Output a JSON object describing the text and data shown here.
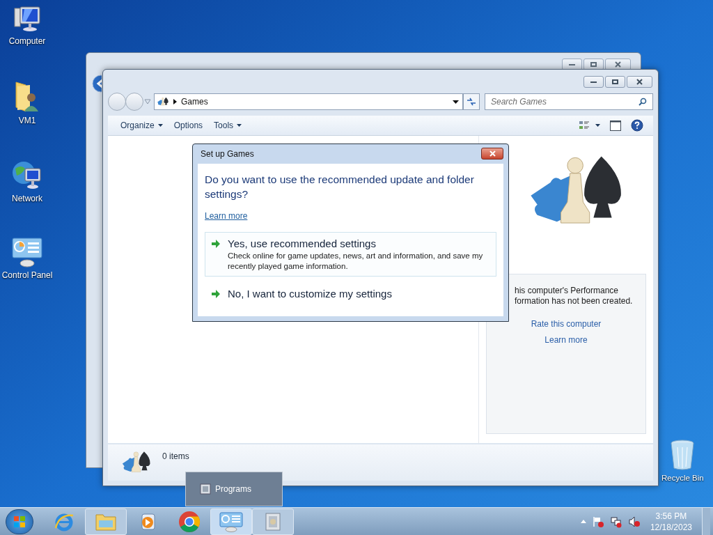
{
  "desktop_icons": [
    {
      "label": "Computer",
      "kind": "computer"
    },
    {
      "label": "VM1",
      "kind": "user-folder"
    },
    {
      "label": "Network",
      "kind": "network"
    },
    {
      "label": "Control Panel",
      "kind": "control-panel"
    }
  ],
  "recycle_bin": {
    "label": "Recycle Bin"
  },
  "window": {
    "address": "Games",
    "search": {
      "placeholder": "Search Games"
    },
    "toolbar": [
      {
        "label": "Organize",
        "dropdown": true
      },
      {
        "label": "Options",
        "dropdown": false
      },
      {
        "label": "Tools",
        "dropdown": true
      }
    ],
    "right_pane": {
      "lines": [
        "his computer's Performance",
        "formation has not been created."
      ],
      "links": [
        "Rate this computer",
        "Learn more"
      ]
    },
    "status": "0 items"
  },
  "dialog": {
    "title": "Set up Games",
    "question": "Do you want to use the recommended update and folder settings?",
    "link": "Learn more",
    "options": [
      {
        "title": "Yes, use recommended settings",
        "description": "Check online for game updates, news, art and information, and save my recently played game information.",
        "highlighted": true
      },
      {
        "title": "No, I want to customize my settings",
        "highlighted": false
      }
    ]
  },
  "taskbar": {
    "items": [
      {
        "kind": "ie",
        "open": false,
        "active": false
      },
      {
        "kind": "explorer",
        "open": true,
        "active": false
      },
      {
        "kind": "media",
        "open": false,
        "active": false
      },
      {
        "kind": "chrome",
        "open": false,
        "active": false
      },
      {
        "kind": "control-panel",
        "open": true,
        "active": true
      },
      {
        "kind": "games",
        "open": true,
        "active": false
      }
    ],
    "popup": {
      "label": "Programs"
    },
    "clock": {
      "time": "3:56 PM",
      "date": "12/18/2023"
    }
  }
}
